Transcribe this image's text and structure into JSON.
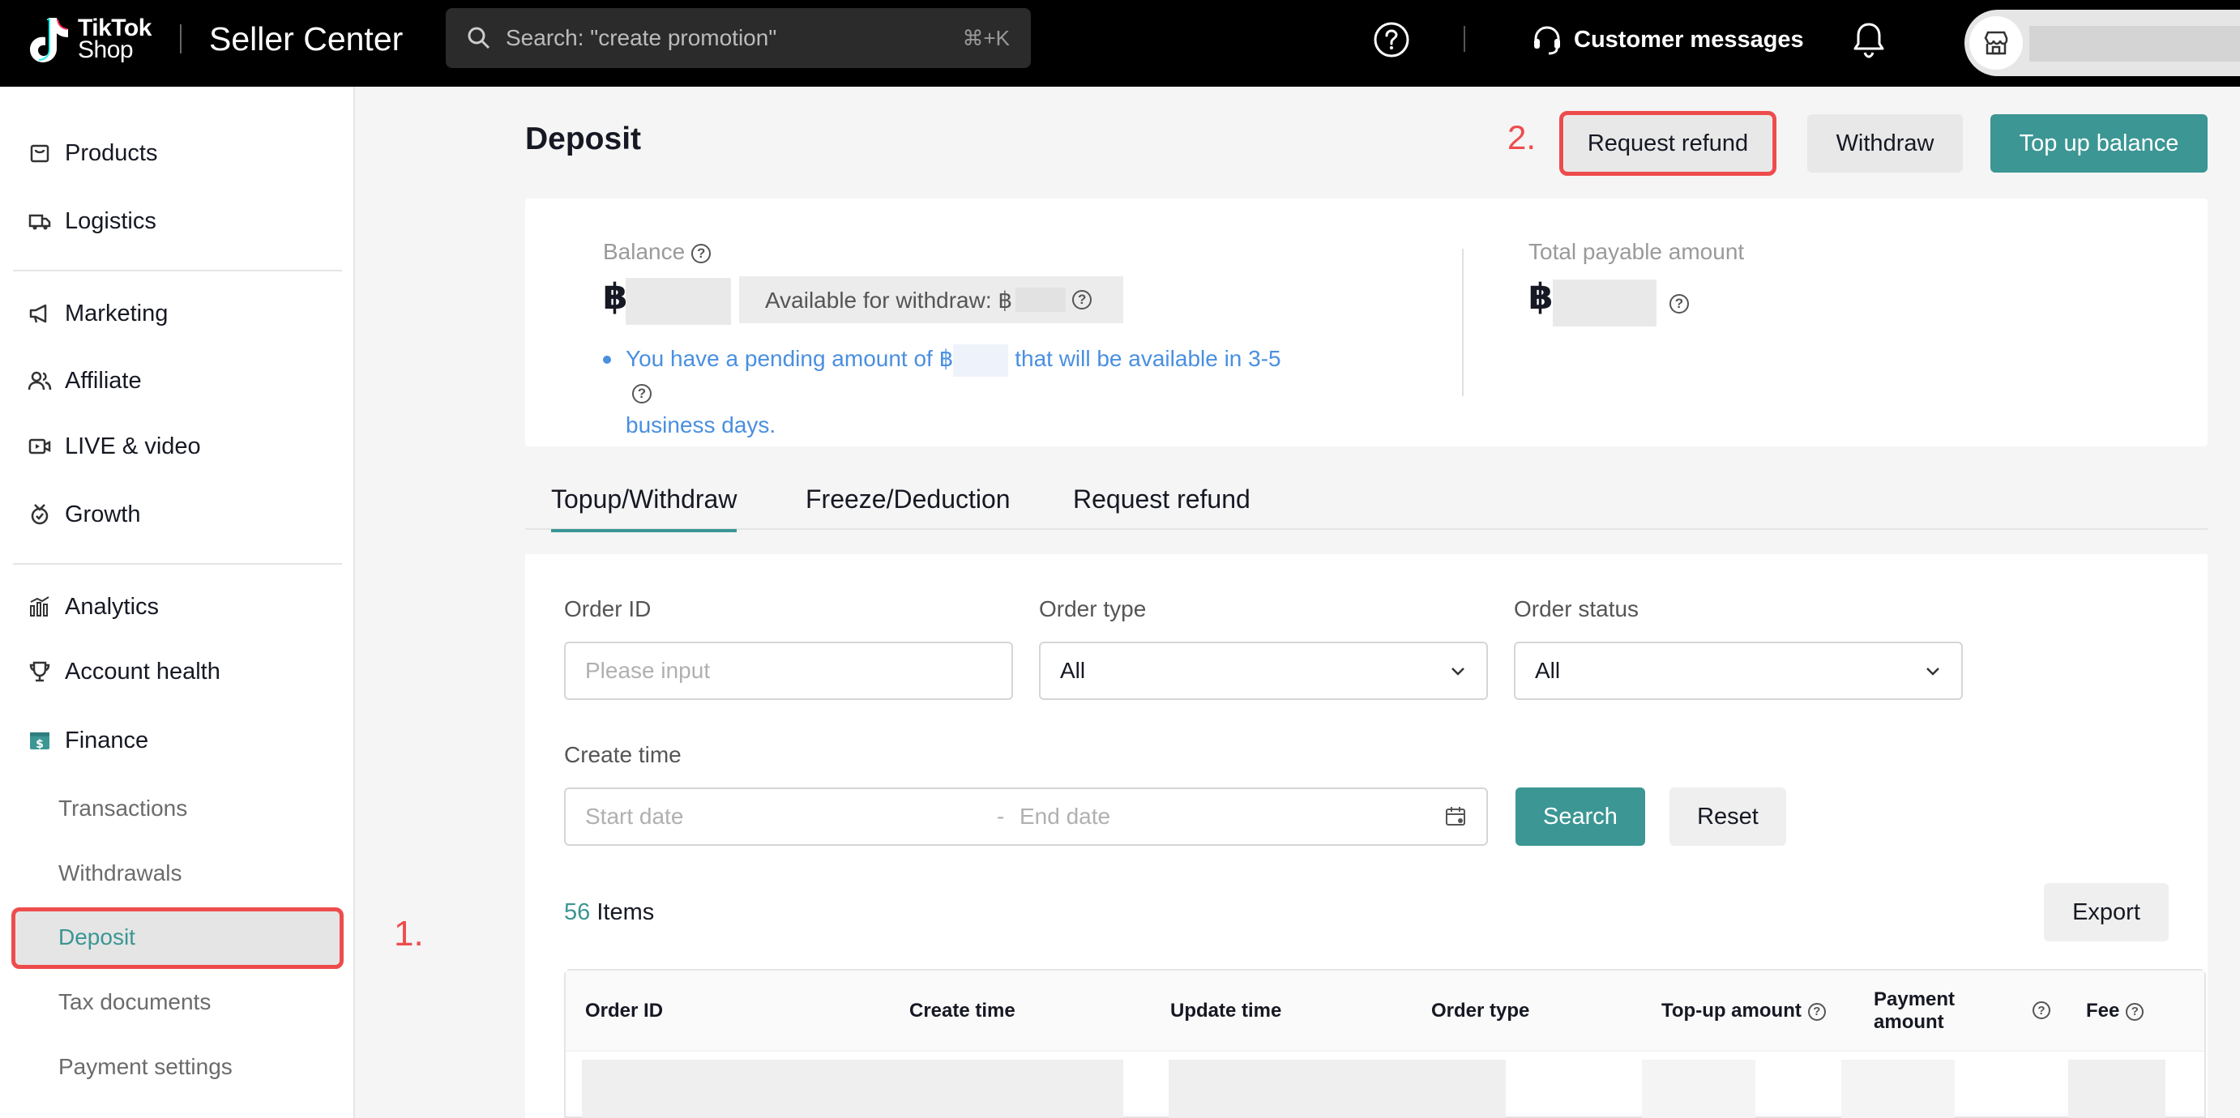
{
  "topbar": {
    "logo_line1": "TikTok",
    "logo_line2": "Shop",
    "product_name": "Seller Center",
    "search_placeholder": "Search: \"create promotion\"",
    "search_shortcut": "⌘+K",
    "customer_messages": "Customer messages"
  },
  "sidebar": {
    "items": [
      {
        "label": "Products",
        "icon": "bag-icon"
      },
      {
        "label": "Logistics",
        "icon": "truck-icon"
      },
      {
        "label": "Marketing",
        "icon": "megaphone-icon"
      },
      {
        "label": "Affiliate",
        "icon": "people-icon"
      },
      {
        "label": "LIVE & video",
        "icon": "video-icon"
      },
      {
        "label": "Growth",
        "icon": "growth-icon"
      },
      {
        "label": "Analytics",
        "icon": "chart-icon"
      },
      {
        "label": "Account health",
        "icon": "trophy-icon"
      },
      {
        "label": "Finance",
        "icon": "dollar-icon"
      }
    ],
    "finance_sub": [
      "Transactions",
      "Withdrawals",
      "Deposit",
      "Tax documents",
      "Payment settings"
    ],
    "active_sub": "Deposit"
  },
  "annotations": {
    "step1": "1.",
    "step2": "2."
  },
  "page": {
    "title": "Deposit",
    "buttons": {
      "request_refund": "Request refund",
      "withdraw": "Withdraw",
      "top_up": "Top up balance"
    }
  },
  "balance": {
    "balance_label": "Balance",
    "currency": "฿",
    "available_label": "Available for withdraw: ฿",
    "pending_pre": "You have a pending amount of ฿",
    "pending_post": "that will be available in 3-5",
    "pending_line2": "business days.",
    "total_payable_label": "Total payable amount"
  },
  "tabs": [
    "Topup/Withdraw",
    "Freeze/Deduction",
    "Request refund"
  ],
  "active_tab": "Topup/Withdraw",
  "filters": {
    "order_id_label": "Order ID",
    "order_id_placeholder": "Please input",
    "order_type_label": "Order type",
    "order_type_value": "All",
    "order_status_label": "Order status",
    "order_status_value": "All",
    "create_time_label": "Create time",
    "start_placeholder": "Start date",
    "range_sep": "-",
    "end_placeholder": "End date",
    "search_btn": "Search",
    "reset_btn": "Reset"
  },
  "results": {
    "count": "56",
    "items_label": "Items",
    "export_btn": "Export"
  },
  "table": {
    "columns": [
      "Order ID",
      "Create time",
      "Update time",
      "Order type",
      "Top-up amount",
      "Payment amount",
      "Fee"
    ]
  },
  "colors": {
    "accent": "#3b9694",
    "annotation": "#ee4c4c",
    "link": "#4a8fe0"
  }
}
